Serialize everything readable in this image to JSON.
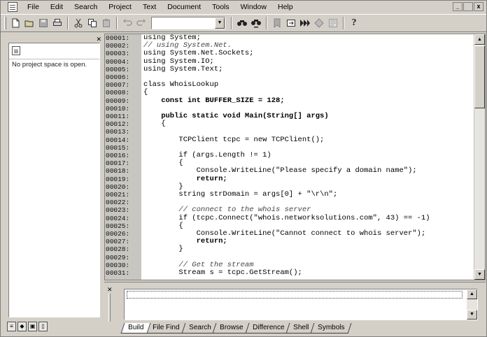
{
  "menu": {
    "items": [
      {
        "label": "File"
      },
      {
        "label": "Edit"
      },
      {
        "label": "Search"
      },
      {
        "label": "Project"
      },
      {
        "label": "Text"
      },
      {
        "label": "Document"
      },
      {
        "label": "Tools"
      },
      {
        "label": "Window"
      },
      {
        "label": "Help"
      }
    ],
    "mdi": {
      "minimize": "_",
      "restore": " ",
      "close": "x"
    }
  },
  "toolbar": {
    "icons": [
      "new-icon",
      "open-icon",
      "save-icon",
      "print-icon",
      "cut-icon",
      "copy-icon",
      "paste-icon",
      "undo-icon",
      "redo-icon"
    ],
    "search_value": "",
    "right_icons": [
      "find-icon",
      "find-next-icon",
      "bookmark-icon",
      "goto-icon",
      "compile-icon",
      "run-icon",
      "format-icon",
      "help-icon"
    ]
  },
  "project": {
    "empty_message": "No project space is open."
  },
  "editor": {
    "line_numbers": [
      "00001:",
      "00002:",
      "00003:",
      "00004:",
      "00005:",
      "00006:",
      "00007:",
      "00008:",
      "00009:",
      "00010:",
      "00011:",
      "00012:",
      "00013:",
      "00014:",
      "00015:",
      "00016:",
      "00017:",
      "00018:",
      "00019:",
      "00020:",
      "00021:",
      "00022:",
      "00023:",
      "00024:",
      "00025:",
      "00026:",
      "00027:",
      "00028:",
      "00029:",
      "00030:",
      "00031:"
    ],
    "lines": [
      {
        "text": "using System;",
        "kind": "code"
      },
      {
        "text": "// using System.Net.",
        "kind": "comment"
      },
      {
        "text": "using System.Net.Sockets;",
        "kind": "code"
      },
      {
        "text": "using System.IO;",
        "kind": "code"
      },
      {
        "text": "using System.Text;",
        "kind": "code"
      },
      {
        "text": "",
        "kind": "code"
      },
      {
        "text": "class WhoisLookup",
        "kind": "code"
      },
      {
        "text": "{",
        "kind": "code"
      },
      {
        "text": "    const int BUFFER_SIZE = 128;",
        "kind": "bold"
      },
      {
        "text": "",
        "kind": "code"
      },
      {
        "text": "    public static void Main(String[] args)",
        "kind": "bold"
      },
      {
        "text": "    {",
        "kind": "code"
      },
      {
        "text": "",
        "kind": "code"
      },
      {
        "text": "        TCPClient tcpc = new TCPClient();",
        "kind": "code"
      },
      {
        "text": "",
        "kind": "code"
      },
      {
        "text": "        if (args.Length != 1)",
        "kind": "code"
      },
      {
        "text": "        {",
        "kind": "code"
      },
      {
        "text": "            Console.WriteLine(\"Please specify a domain name\");",
        "kind": "code"
      },
      {
        "text": "            return;",
        "kind": "bold"
      },
      {
        "text": "        }",
        "kind": "code"
      },
      {
        "text": "        string strDomain = args[0] + \"\\r\\n\";",
        "kind": "code"
      },
      {
        "text": "",
        "kind": "code"
      },
      {
        "text": "        // connect to the whois server",
        "kind": "comment"
      },
      {
        "text": "        if (tcpc.Connect(\"whois.networksolutions.com\", 43) == -1)",
        "kind": "code"
      },
      {
        "text": "        {",
        "kind": "code"
      },
      {
        "text": "            Console.WriteLine(\"Cannot connect to whois server\");",
        "kind": "code"
      },
      {
        "text": "            return;",
        "kind": "bold"
      },
      {
        "text": "        }",
        "kind": "code"
      },
      {
        "text": "",
        "kind": "code"
      },
      {
        "text": "        // Get the stream",
        "kind": "comment"
      },
      {
        "text": "        Stream s = tcpc.GetStream();",
        "kind": "code"
      }
    ]
  },
  "output": {
    "tabs": [
      {
        "label": "Build",
        "active": true
      },
      {
        "label": "File Find",
        "active": false
      },
      {
        "label": "Search",
        "active": false
      },
      {
        "label": "Browse",
        "active": false
      },
      {
        "label": "Difference",
        "active": false
      },
      {
        "label": "Shell",
        "active": false
      },
      {
        "label": "Symbols",
        "active": false
      }
    ]
  }
}
